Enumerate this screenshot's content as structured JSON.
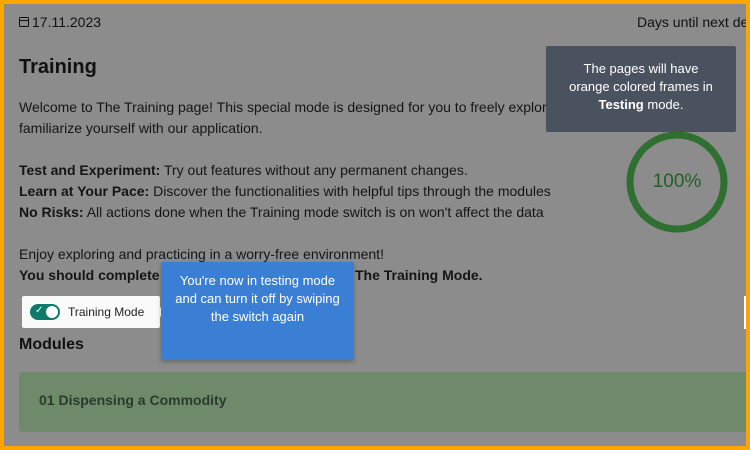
{
  "header": {
    "date": "17.11.2023",
    "days_until": "Days until next de"
  },
  "page": {
    "title": "Training",
    "intro_line1": "Welcome to The Training page! This special mode is designed for you to freely explore",
    "intro_line2": "familiarize yourself with our application.",
    "items": [
      {
        "bold": "Test and Experiment:",
        "text": " Try out features without any permanent changes."
      },
      {
        "bold": "Learn at Your Pace:",
        "text": " Discover the functionalities with helpful tips through the modules"
      },
      {
        "bold": "No Risks:",
        "text": " All actions done when the Training mode switch is on won't affect the data"
      }
    ],
    "enjoy": "Enjoy exploring and practicing in a worry-free environment!",
    "complete_start": "You should complete th",
    "complete_end": "The Training Mode."
  },
  "toggle": {
    "label": "Training Mode",
    "on": true
  },
  "modules": {
    "heading": "Modules",
    "items": [
      {
        "title": "01 Dispensing a Commodity"
      }
    ]
  },
  "progress": {
    "value_label": "100%",
    "fraction": 1.0,
    "color": "#2f6f32"
  },
  "tooltips": {
    "frames": {
      "line1": "The pages will have",
      "line2": "orange colored frames in",
      "bold": "Testing",
      "line3_suffix": " mode."
    },
    "testing": "You're now in testing mode and can turn it off by swiping the switch again"
  },
  "colors": {
    "frame": "#ffa500",
    "overlay": "#8c8c8c",
    "toggle_on": "#0d7a6a",
    "tooltip_blue": "#3b7fd4",
    "tooltip_dark": "#4a5260"
  }
}
